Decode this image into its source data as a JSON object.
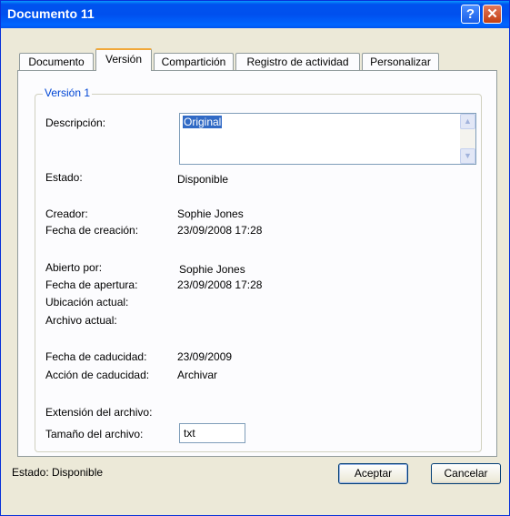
{
  "window": {
    "title": "Documento 11",
    "help_label": "?",
    "close_label": "✕"
  },
  "tabs": [
    {
      "label": "Documento"
    },
    {
      "label": "Versión"
    },
    {
      "label": "Compartición"
    },
    {
      "label": "Registro de actividad"
    },
    {
      "label": "Personalizar"
    }
  ],
  "active_tab": "Versión",
  "group": {
    "title": "Versión 1"
  },
  "fields": {
    "descripcion_label": "Descripción:",
    "descripcion_value": "Original",
    "estado_label": "Estado:",
    "estado_value": "Disponible",
    "creador_label": "Creador:",
    "creador_value": "Sophie Jones",
    "fecha_creacion_label": "Fecha de creación:",
    "fecha_creacion_value": "23/09/2008 17:28",
    "abierto_por_label": "Abierto por:",
    "abierto_por_value": "Sophie Jones",
    "fecha_apertura_label": "Fecha de apertura:",
    "fecha_apertura_value": "23/09/2008 17:28",
    "ubicacion_label": "Ubicación actual:",
    "archivo_actual_label": "Archivo actual:",
    "fecha_caducidad_label": "Fecha de caducidad:",
    "fecha_caducidad_value": "23/09/2009",
    "accion_caducidad_label": "Acción de caducidad:",
    "accion_caducidad_value": "Archivar",
    "extension_label": "Extensión del archivo:",
    "extension_value": "txt",
    "tamano_label": "Tamaño del archivo:"
  },
  "footer": {
    "status": "Estado: Disponible",
    "accept_label": "Aceptar",
    "cancel_label": "Cancelar"
  }
}
